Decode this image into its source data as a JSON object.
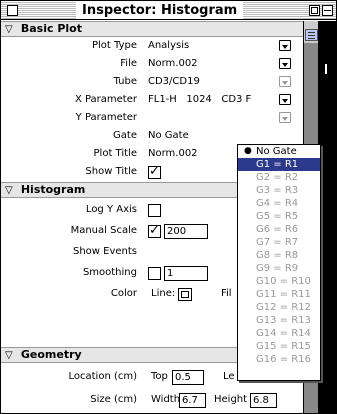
{
  "window": {
    "title": "Inspector: Histogram"
  },
  "sections": {
    "basic_plot": "Basic Plot",
    "histogram": "Histogram",
    "geometry": "Geometry"
  },
  "basic_plot": {
    "plot_type": {
      "label": "Plot Type",
      "value": "Analysis"
    },
    "file": {
      "label": "File",
      "value": "Norm.002"
    },
    "tube": {
      "label": "Tube",
      "value": "CD3/CD19"
    },
    "x_parameter": {
      "label": "X Parameter",
      "value": "FL1-H   1024   CD3 F"
    },
    "y_parameter": {
      "label": "Y Parameter",
      "value": ""
    },
    "gate": {
      "label": "Gate",
      "value": "No Gate"
    },
    "plot_title": {
      "label": "Plot Title",
      "value": "Norm.002"
    },
    "show_title": {
      "label": "Show Title",
      "checked": true
    }
  },
  "histogram": {
    "log_y_axis": {
      "label": "Log Y Axis",
      "checked": false
    },
    "manual_scale": {
      "label": "Manual Scale",
      "checked": true,
      "value": "200"
    },
    "show_events": {
      "label": "Show Events"
    },
    "smoothing": {
      "label": "Smoothing",
      "checked": false,
      "value": "1"
    },
    "color": {
      "label": "Color",
      "line_label": "Line:",
      "fill_label": "Fil"
    }
  },
  "geometry": {
    "location": {
      "label": "Location (cm)",
      "top_label": "Top",
      "top_value": "0.5",
      "left_label": "Le"
    },
    "size": {
      "label": "Size (cm)",
      "width_label": "Width",
      "width_value": "6.7",
      "height_label": "Height",
      "height_value": "6.8"
    }
  },
  "gate_menu": {
    "options": [
      {
        "label": "No Gate",
        "checked": true,
        "enabled": true
      },
      {
        "label": "G1 = R1",
        "selected": true,
        "enabled": true
      },
      {
        "label": "G2 = R2",
        "enabled": false
      },
      {
        "label": "G3 = R3",
        "enabled": false
      },
      {
        "label": "G4 = R4",
        "enabled": false
      },
      {
        "label": "G5 = R5",
        "enabled": false
      },
      {
        "label": "G6 = R6",
        "enabled": false
      },
      {
        "label": "G7 = R7",
        "enabled": false
      },
      {
        "label": "G8 = R8",
        "enabled": false
      },
      {
        "label": "G9 = R9",
        "enabled": false
      },
      {
        "label": "G10 = R10",
        "enabled": false
      },
      {
        "label": "G11 = R11",
        "enabled": false
      },
      {
        "label": "G12 = R12",
        "enabled": false
      },
      {
        "label": "G13 = R13",
        "enabled": false
      },
      {
        "label": "G14 = R14",
        "enabled": false
      },
      {
        "label": "G15 = R15",
        "enabled": false
      },
      {
        "label": "G16 = R16",
        "enabled": false
      }
    ]
  },
  "colors": {
    "selection": "#2c3a8e",
    "section_bg": "#e6e6e6",
    "scroll_thumb": "#b9c6f2"
  }
}
